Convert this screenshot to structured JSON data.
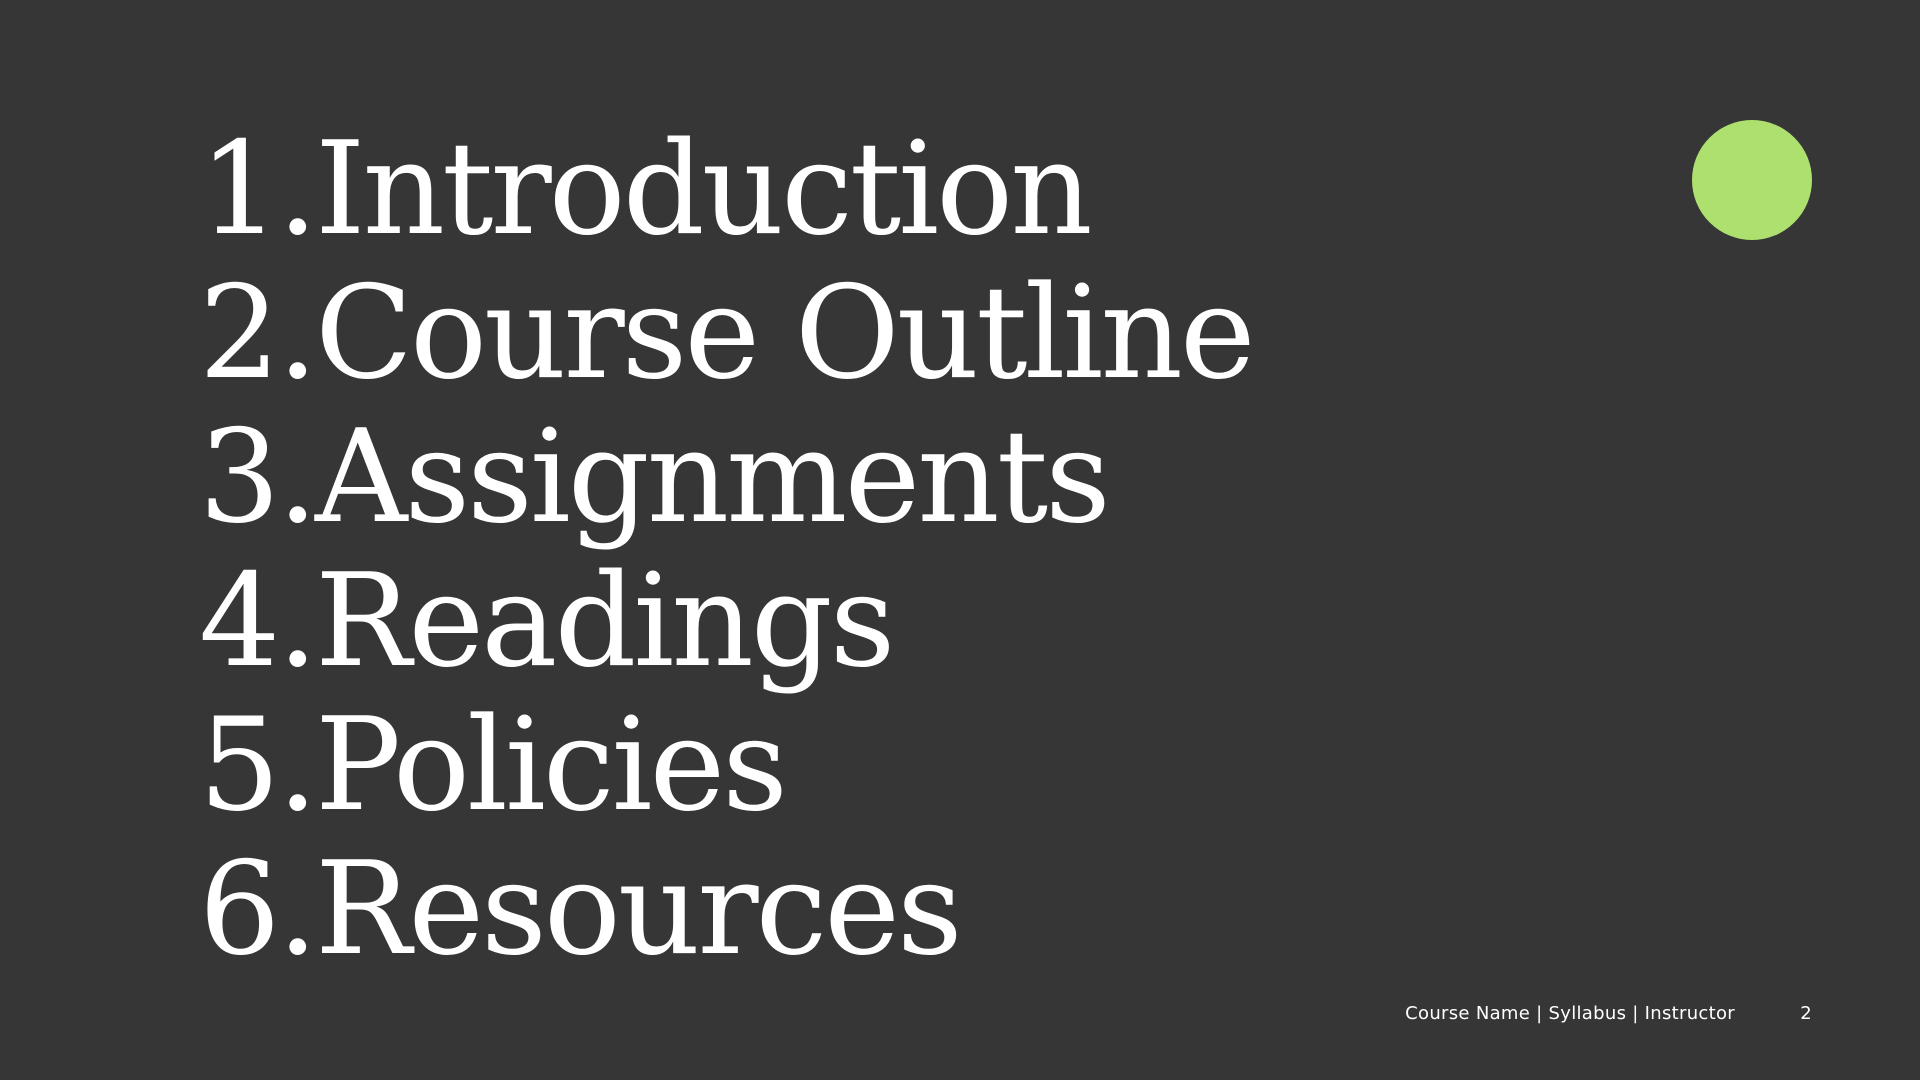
{
  "agenda": {
    "items": [
      {
        "number": "1.",
        "label": "Introduction"
      },
      {
        "number": "2.",
        "label": "Course Outline"
      },
      {
        "number": "3.",
        "label": "Assignments"
      },
      {
        "number": "4.",
        "label": "Readings"
      },
      {
        "number": "5.",
        "label": "Policies"
      },
      {
        "number": "6.",
        "label": "Resources"
      }
    ]
  },
  "footer": {
    "text": "Course Name | Syllabus | Instructor",
    "page_number": "2"
  },
  "colors": {
    "background": "#363636",
    "accent": "#ade06e",
    "text": "#ffffff"
  }
}
